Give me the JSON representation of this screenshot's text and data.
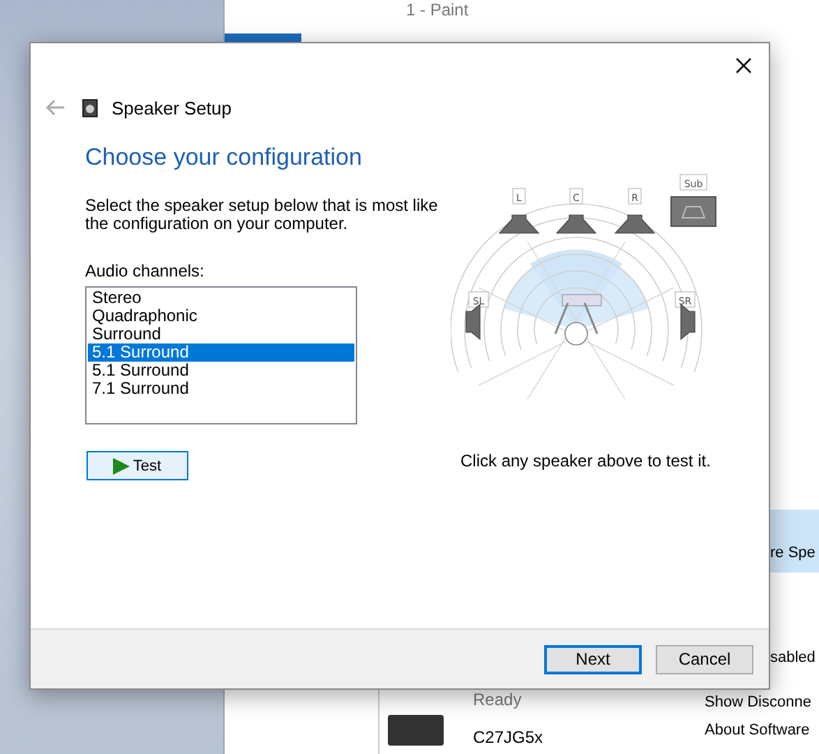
{
  "paint_window": {
    "title": "1 - Paint"
  },
  "sound_panel": {
    "device_status": "Ready",
    "device_name": "C27JG5x",
    "menu_items": [
      {
        "label": "re Spe",
        "selected": true
      },
      {
        "label": "sabled",
        "selected": false
      },
      {
        "label": "Show Disconne",
        "selected": false
      },
      {
        "label": "About Software",
        "selected": false
      }
    ]
  },
  "dialog": {
    "title": "Speaker Setup",
    "heading": "Choose your configuration",
    "description": "Select the speaker setup below that is most like the configuration on your computer.",
    "list_label": "Audio channels:",
    "channels": [
      {
        "label": "Stereo",
        "selected": false
      },
      {
        "label": "Quadraphonic",
        "selected": false
      },
      {
        "label": "Surround",
        "selected": false
      },
      {
        "label": "5.1 Surround",
        "selected": true
      },
      {
        "label": "5.1 Surround",
        "selected": false
      },
      {
        "label": "7.1 Surround",
        "selected": false
      }
    ],
    "test_button": "Test",
    "speakers": [
      {
        "label": "L",
        "kind": "front"
      },
      {
        "label": "C",
        "kind": "front"
      },
      {
        "label": "R",
        "kind": "front"
      },
      {
        "label": "Sub",
        "kind": "sub"
      },
      {
        "label": "SL",
        "kind": "left"
      },
      {
        "label": "SR",
        "kind": "right"
      }
    ],
    "hint": "Click any speaker above to test it.",
    "buttons": [
      {
        "label": "Next",
        "selected": true
      },
      {
        "label": "Cancel",
        "selected": false
      }
    ]
  }
}
